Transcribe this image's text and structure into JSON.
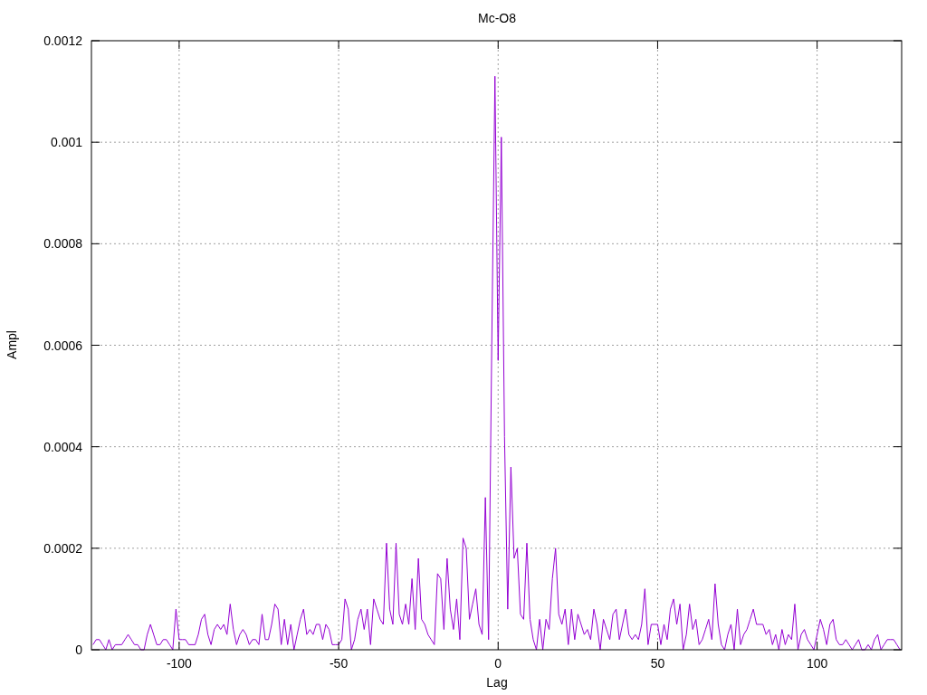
{
  "plot": {
    "chart_data": {
      "type": "line",
      "title": "Mc-O8",
      "xlabel": "Lag",
      "ylabel": "Ampl",
      "grid": true,
      "xlim": [
        -127.5,
        126.5
      ],
      "ylim": [
        0,
        0.0012
      ],
      "xticks": [
        -100,
        -50,
        0,
        50,
        100
      ],
      "yticks": [
        {
          "value": 0,
          "label": "0"
        },
        {
          "value": 0.0002,
          "label": "0.0002"
        },
        {
          "value": 0.0004,
          "label": "0.0004"
        },
        {
          "value": 0.0006,
          "label": "0.0006"
        },
        {
          "value": 0.0008,
          "label": "0.0008"
        },
        {
          "value": 0.001,
          "label": "0.001"
        },
        {
          "value": 0.0012,
          "label": "0.0012"
        }
      ],
      "x": [
        -127,
        -126,
        -125,
        -124,
        -123,
        -122,
        -121,
        -120,
        -119,
        -118,
        -117,
        -116,
        -115,
        -114,
        -113,
        -112,
        -111,
        -110,
        -109,
        -108,
        -107,
        -106,
        -105,
        -104,
        -103,
        -102,
        -101,
        -100,
        -99,
        -98,
        -97,
        -96,
        -95,
        -94,
        -93,
        -92,
        -91,
        -90,
        -89,
        -88,
        -87,
        -86,
        -85,
        -84,
        -83,
        -82,
        -81,
        -80,
        -79,
        -78,
        -77,
        -76,
        -75,
        -74,
        -73,
        -72,
        -71,
        -70,
        -69,
        -68,
        -67,
        -66,
        -65,
        -64,
        -63,
        -62,
        -61,
        -60,
        -59,
        -58,
        -57,
        -56,
        -55,
        -54,
        -53,
        -52,
        -51,
        -50,
        -49,
        -48,
        -47,
        -46,
        -45,
        -44,
        -43,
        -42,
        -41,
        -40,
        -39,
        -38,
        -37,
        -36,
        -35,
        -34,
        -33,
        -32,
        -31,
        -30,
        -29,
        -28,
        -27,
        -26,
        -25,
        -24,
        -23,
        -22,
        -21,
        -20,
        -19,
        -18,
        -17,
        -16,
        -15,
        -14,
        -13,
        -12,
        -11,
        -10,
        -9,
        -8,
        -7,
        -6,
        -5,
        -4,
        -3,
        -2,
        -1,
        0,
        1,
        2,
        3,
        4,
        5,
        6,
        7,
        8,
        9,
        10,
        11,
        12,
        13,
        14,
        15,
        16,
        17,
        18,
        19,
        20,
        21,
        22,
        23,
        24,
        25,
        26,
        27,
        28,
        29,
        30,
        31,
        32,
        33,
        34,
        35,
        36,
        37,
        38,
        39,
        40,
        41,
        42,
        43,
        44,
        45,
        46,
        47,
        48,
        49,
        50,
        51,
        52,
        53,
        54,
        55,
        56,
        57,
        58,
        59,
        60,
        61,
        62,
        63,
        64,
        65,
        66,
        67,
        68,
        69,
        70,
        71,
        72,
        73,
        74,
        75,
        76,
        77,
        78,
        79,
        80,
        81,
        82,
        83,
        84,
        85,
        86,
        87,
        88,
        89,
        90,
        91,
        92,
        93,
        94,
        95,
        96,
        97,
        98,
        99,
        100,
        101,
        102,
        103,
        104,
        105,
        106,
        107,
        108,
        109,
        110,
        111,
        112,
        113,
        114,
        115,
        116,
        117,
        118,
        119,
        120,
        121,
        122,
        123,
        124,
        125,
        126
      ],
      "series": [
        {
          "color": "#9400d3",
          "values": [
            1e-05,
            2e-05,
            2e-05,
            1e-05,
            0,
            2e-05,
            0,
            1e-05,
            1e-05,
            1e-05,
            2e-05,
            3e-05,
            2e-05,
            1e-05,
            1e-05,
            0,
            0,
            3e-05,
            5e-05,
            3e-05,
            1e-05,
            1e-05,
            2e-05,
            2e-05,
            1e-05,
            0,
            8e-05,
            2e-05,
            2e-05,
            2e-05,
            1e-05,
            1e-05,
            1e-05,
            3e-05,
            6e-05,
            7e-05,
            3e-05,
            1e-05,
            4e-05,
            5e-05,
            4e-05,
            5e-05,
            3e-05,
            9e-05,
            4e-05,
            1e-05,
            3e-05,
            4e-05,
            3e-05,
            1e-05,
            2e-05,
            2e-05,
            1e-05,
            7e-05,
            2e-05,
            2e-05,
            5e-05,
            9e-05,
            8e-05,
            1e-05,
            6e-05,
            1e-05,
            5e-05,
            0,
            3e-05,
            6e-05,
            8e-05,
            3e-05,
            4e-05,
            3e-05,
            5e-05,
            5e-05,
            2e-05,
            5e-05,
            4e-05,
            1e-05,
            1e-05,
            1e-05,
            2e-05,
            0.0001,
            8e-05,
            0,
            2e-05,
            6e-05,
            8e-05,
            4e-05,
            8e-05,
            1e-05,
            0.0001,
            8e-05,
            6e-05,
            5e-05,
            0.00021,
            8e-05,
            5e-05,
            0.00021,
            7e-05,
            5e-05,
            9e-05,
            5e-05,
            0.00014,
            4e-05,
            0.00018,
            6e-05,
            5e-05,
            3e-05,
            2e-05,
            1e-05,
            0.00015,
            0.00014,
            4e-05,
            0.00018,
            8e-05,
            4e-05,
            0.0001,
            2e-05,
            0.00022,
            0.0002,
            6e-05,
            9e-05,
            0.00012,
            5e-05,
            3e-05,
            0.0003,
            2e-05,
            0.0006,
            0.00113,
            0.00057,
            0.00101,
            0.00042,
            8e-05,
            0.00036,
            0.00018,
            0.0002,
            7e-05,
            6e-05,
            0.00021,
            6e-05,
            2e-05,
            0,
            6e-05,
            0,
            6e-05,
            4e-05,
            0.00014,
            0.0002,
            7e-05,
            5e-05,
            8e-05,
            1e-05,
            8e-05,
            2e-05,
            7e-05,
            5e-05,
            3e-05,
            4e-05,
            2e-05,
            8e-05,
            5e-05,
            0,
            6e-05,
            4e-05,
            2e-05,
            7e-05,
            8e-05,
            2e-05,
            5e-05,
            8e-05,
            3e-05,
            2e-05,
            3e-05,
            2e-05,
            5e-05,
            0.00012,
            1e-05,
            5e-05,
            5e-05,
            5e-05,
            1e-05,
            5e-05,
            2e-05,
            8e-05,
            0.0001,
            5e-05,
            9e-05,
            0,
            3e-05,
            9e-05,
            4e-05,
            6e-05,
            1e-05,
            2e-05,
            4e-05,
            6e-05,
            2e-05,
            0.00013,
            5e-05,
            1e-05,
            0,
            3e-05,
            5e-05,
            0,
            8e-05,
            1e-05,
            3e-05,
            4e-05,
            6e-05,
            8e-05,
            5e-05,
            5e-05,
            5e-05,
            3e-05,
            4e-05,
            1e-05,
            3e-05,
            0,
            4e-05,
            1e-05,
            3e-05,
            2e-05,
            9e-05,
            0,
            3e-05,
            4e-05,
            2e-05,
            1e-05,
            0,
            3e-05,
            6e-05,
            4e-05,
            1e-05,
            5e-05,
            6e-05,
            2e-05,
            1e-05,
            1e-05,
            2e-05,
            1e-05,
            0,
            1e-05,
            2e-05,
            0,
            0,
            1e-05,
            0,
            2e-05,
            3e-05,
            0,
            1e-05,
            2e-05,
            2e-05,
            2e-05,
            1e-05,
            0
          ]
        }
      ]
    }
  }
}
